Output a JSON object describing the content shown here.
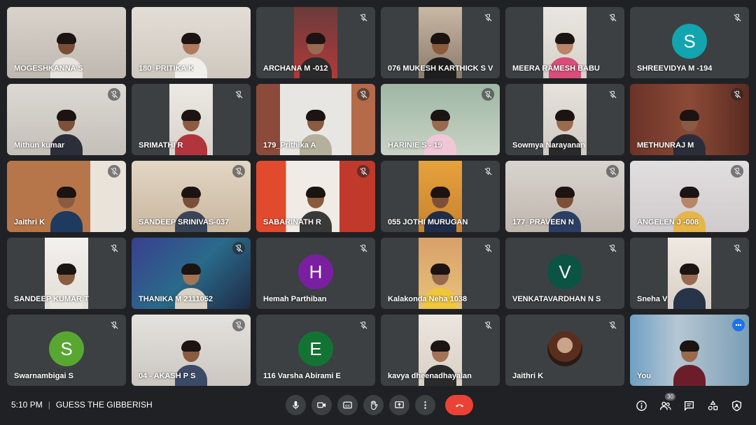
{
  "participants": [
    {
      "name": "MOGESHKANNA S",
      "muted": false
    },
    {
      "name": "180_PRITIKA K",
      "muted": false
    },
    {
      "name": "ARCHANA M -012",
      "muted": true
    },
    {
      "name": "076 MUKESH KARTHICK S V",
      "muted": true
    },
    {
      "name": "MEERA RAMESH BABU",
      "muted": true
    },
    {
      "name": "SHREEVIDYA M -194",
      "muted": true,
      "initial": "S",
      "avatar_color": "#12a4af"
    },
    {
      "name": "Mithun kumar",
      "muted": true
    },
    {
      "name": "SRIMATHI R",
      "muted": true
    },
    {
      "name": "179_Prithika A",
      "muted": true
    },
    {
      "name": "HARINIE S - 19",
      "muted": true
    },
    {
      "name": "Sowmya Narayanan",
      "muted": true
    },
    {
      "name": "METHUNRAJ M",
      "muted": true
    },
    {
      "name": "Jaithri K",
      "muted": true
    },
    {
      "name": "SANDEEP SRINIVAS-037",
      "muted": true
    },
    {
      "name": "SABARINATH R",
      "muted": true
    },
    {
      "name": "055 JOTHI MURUGAN",
      "muted": true
    },
    {
      "name": "177_PRAVEEN N",
      "muted": true
    },
    {
      "name": "ANGELEN J -008",
      "muted": true
    },
    {
      "name": "SANDEEP KUMAR T",
      "muted": true
    },
    {
      "name": "THANIKA M 2111052",
      "muted": true
    },
    {
      "name": "Hemah Parthiban",
      "muted": true,
      "initial": "H",
      "avatar_color": "#7b1fa2"
    },
    {
      "name": "Kalakonda Neha 1038",
      "muted": true
    },
    {
      "name": "VENKATAVARDHAN N S",
      "muted": true,
      "initial": "V",
      "avatar_color": "#0b5345"
    },
    {
      "name": "Sneha V",
      "muted": true
    },
    {
      "name": "Swarnambigai S",
      "muted": true,
      "initial": "S",
      "avatar_color": "#58a731"
    },
    {
      "name": "04 - AKASH P S",
      "muted": true
    },
    {
      "name": "116 Varsha Abirami E",
      "muted": true,
      "initial": "E",
      "avatar_color": "#137333"
    },
    {
      "name": "kavya dheenadhayalan",
      "muted": true
    },
    {
      "name": "Jaithri K",
      "muted": true
    },
    {
      "name": "You",
      "muted": false
    }
  ],
  "bottom_bar": {
    "time": "5:10 PM",
    "separator": "|",
    "meeting_title": "GUESS THE GIBBERISH",
    "participant_count": "30"
  },
  "colors": {
    "background": "#202124",
    "tile": "#3c4043",
    "end_call": "#ea4335",
    "more_options": "#1a73e8"
  },
  "icons": {
    "controls": [
      "microphone-icon",
      "camera-icon",
      "captions-icon",
      "raise-hand-icon",
      "present-screen-icon",
      "more-options-icon",
      "end-call-icon"
    ],
    "right": [
      "info-icon",
      "people-icon",
      "chat-icon",
      "activities-icon",
      "host-controls-icon"
    ]
  }
}
